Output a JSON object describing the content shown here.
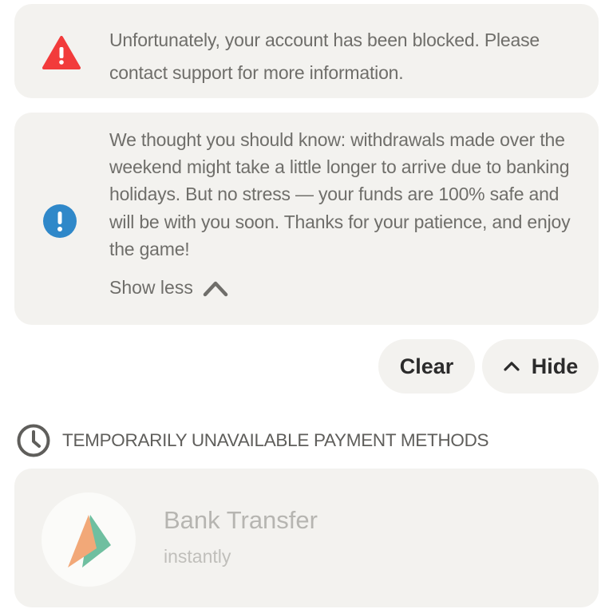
{
  "alerts": [
    {
      "icon": "warning-triangle-icon",
      "color": "#f23b3b",
      "text": "Unfortunately, your account has been blocked. Please contact support for more information."
    },
    {
      "icon": "info-exclamation-icon",
      "color": "#2f88c9",
      "text": "We thought you should know: withdrawals made over the weekend might take a little longer to arrive due to banking holidays. But no stress — your funds are 100% safe and will be with you soon. Thanks for your patience, and enjoy the game!",
      "toggle_label": "Show less"
    }
  ],
  "actions": {
    "clear_label": "Clear",
    "hide_label": "Hide"
  },
  "section": {
    "icon": "clock-icon",
    "title": "TEMPORARILY UNAVAILABLE PAYMENT METHODS"
  },
  "payment_methods": [
    {
      "icon": "bank-transfer-logo-icon",
      "name": "Bank Transfer",
      "speed": "instantly"
    }
  ],
  "colors": {
    "card_bg": "#f3f2ef",
    "text": "#6f6e6a",
    "disabled_text": "#b6b5b1",
    "logo_orange": "#f2a878",
    "logo_green": "#6fbfa0"
  }
}
